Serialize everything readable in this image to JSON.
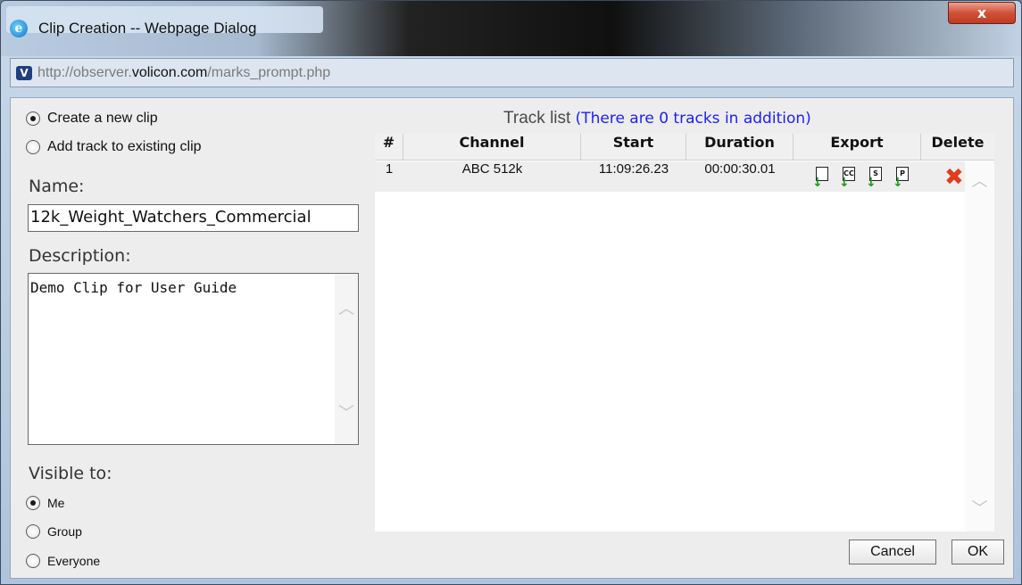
{
  "window": {
    "title": "Clip Creation -- Webpage Dialog",
    "close_label": "x",
    "url_prefix": "http://observer.",
    "url_domain": "volicon.com",
    "url_path": "/marks_prompt.php",
    "address_icon": "V"
  },
  "clip_mode": {
    "options": [
      {
        "label": "Create a new clip",
        "checked": true
      },
      {
        "label": "Add track to existing clip",
        "checked": false
      }
    ]
  },
  "name": {
    "label": "Name:",
    "value": "12k_Weight_Watchers_Commercial"
  },
  "description": {
    "label": "Description:",
    "value": "Demo Clip for User Guide"
  },
  "visibility": {
    "label": "Visible to:",
    "options": [
      {
        "label": "Me",
        "checked": true
      },
      {
        "label": "Group",
        "checked": false
      },
      {
        "label": "Everyone",
        "checked": false
      }
    ]
  },
  "track_list": {
    "title": "Track list",
    "subtitle": "(There are 0 tracks in addition)",
    "columns": [
      "#",
      "Channel",
      "Start",
      "Duration",
      "Export",
      "Delete"
    ],
    "rows": [
      {
        "num": "1",
        "channel": "ABC 512k",
        "start": "11:09:26.23",
        "duration": "00:00:30.01",
        "exports": [
          "blank",
          "CC",
          "S",
          "P"
        ]
      }
    ]
  },
  "buttons": {
    "cancel": "Cancel",
    "ok": "OK"
  },
  "colors": {
    "link_blue": "#1d1dff",
    "delete_red": "#e33b1c",
    "export_green": "#1f9a1f"
  }
}
